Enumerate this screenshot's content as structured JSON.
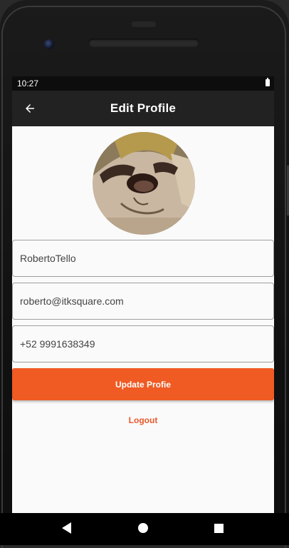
{
  "status_bar": {
    "time": "10:27",
    "battery_icon": "battery-full-icon"
  },
  "app_bar": {
    "title": "Edit Profile",
    "back_icon": "arrow-back-icon"
  },
  "profile": {
    "avatar": "avatar-image",
    "username": "RobertoTello",
    "email": "roberto@itksquare.com",
    "phone": "+52 9991638349"
  },
  "actions": {
    "update_label": "Update Profie",
    "logout_label": "Logout"
  },
  "nav": {
    "back_icon": "nav-back-icon",
    "home_icon": "nav-home-icon",
    "recents_icon": "nav-recents-icon"
  },
  "colors": {
    "accent": "#f05a23",
    "app_bar": "#222222",
    "background": "#fafafa"
  }
}
